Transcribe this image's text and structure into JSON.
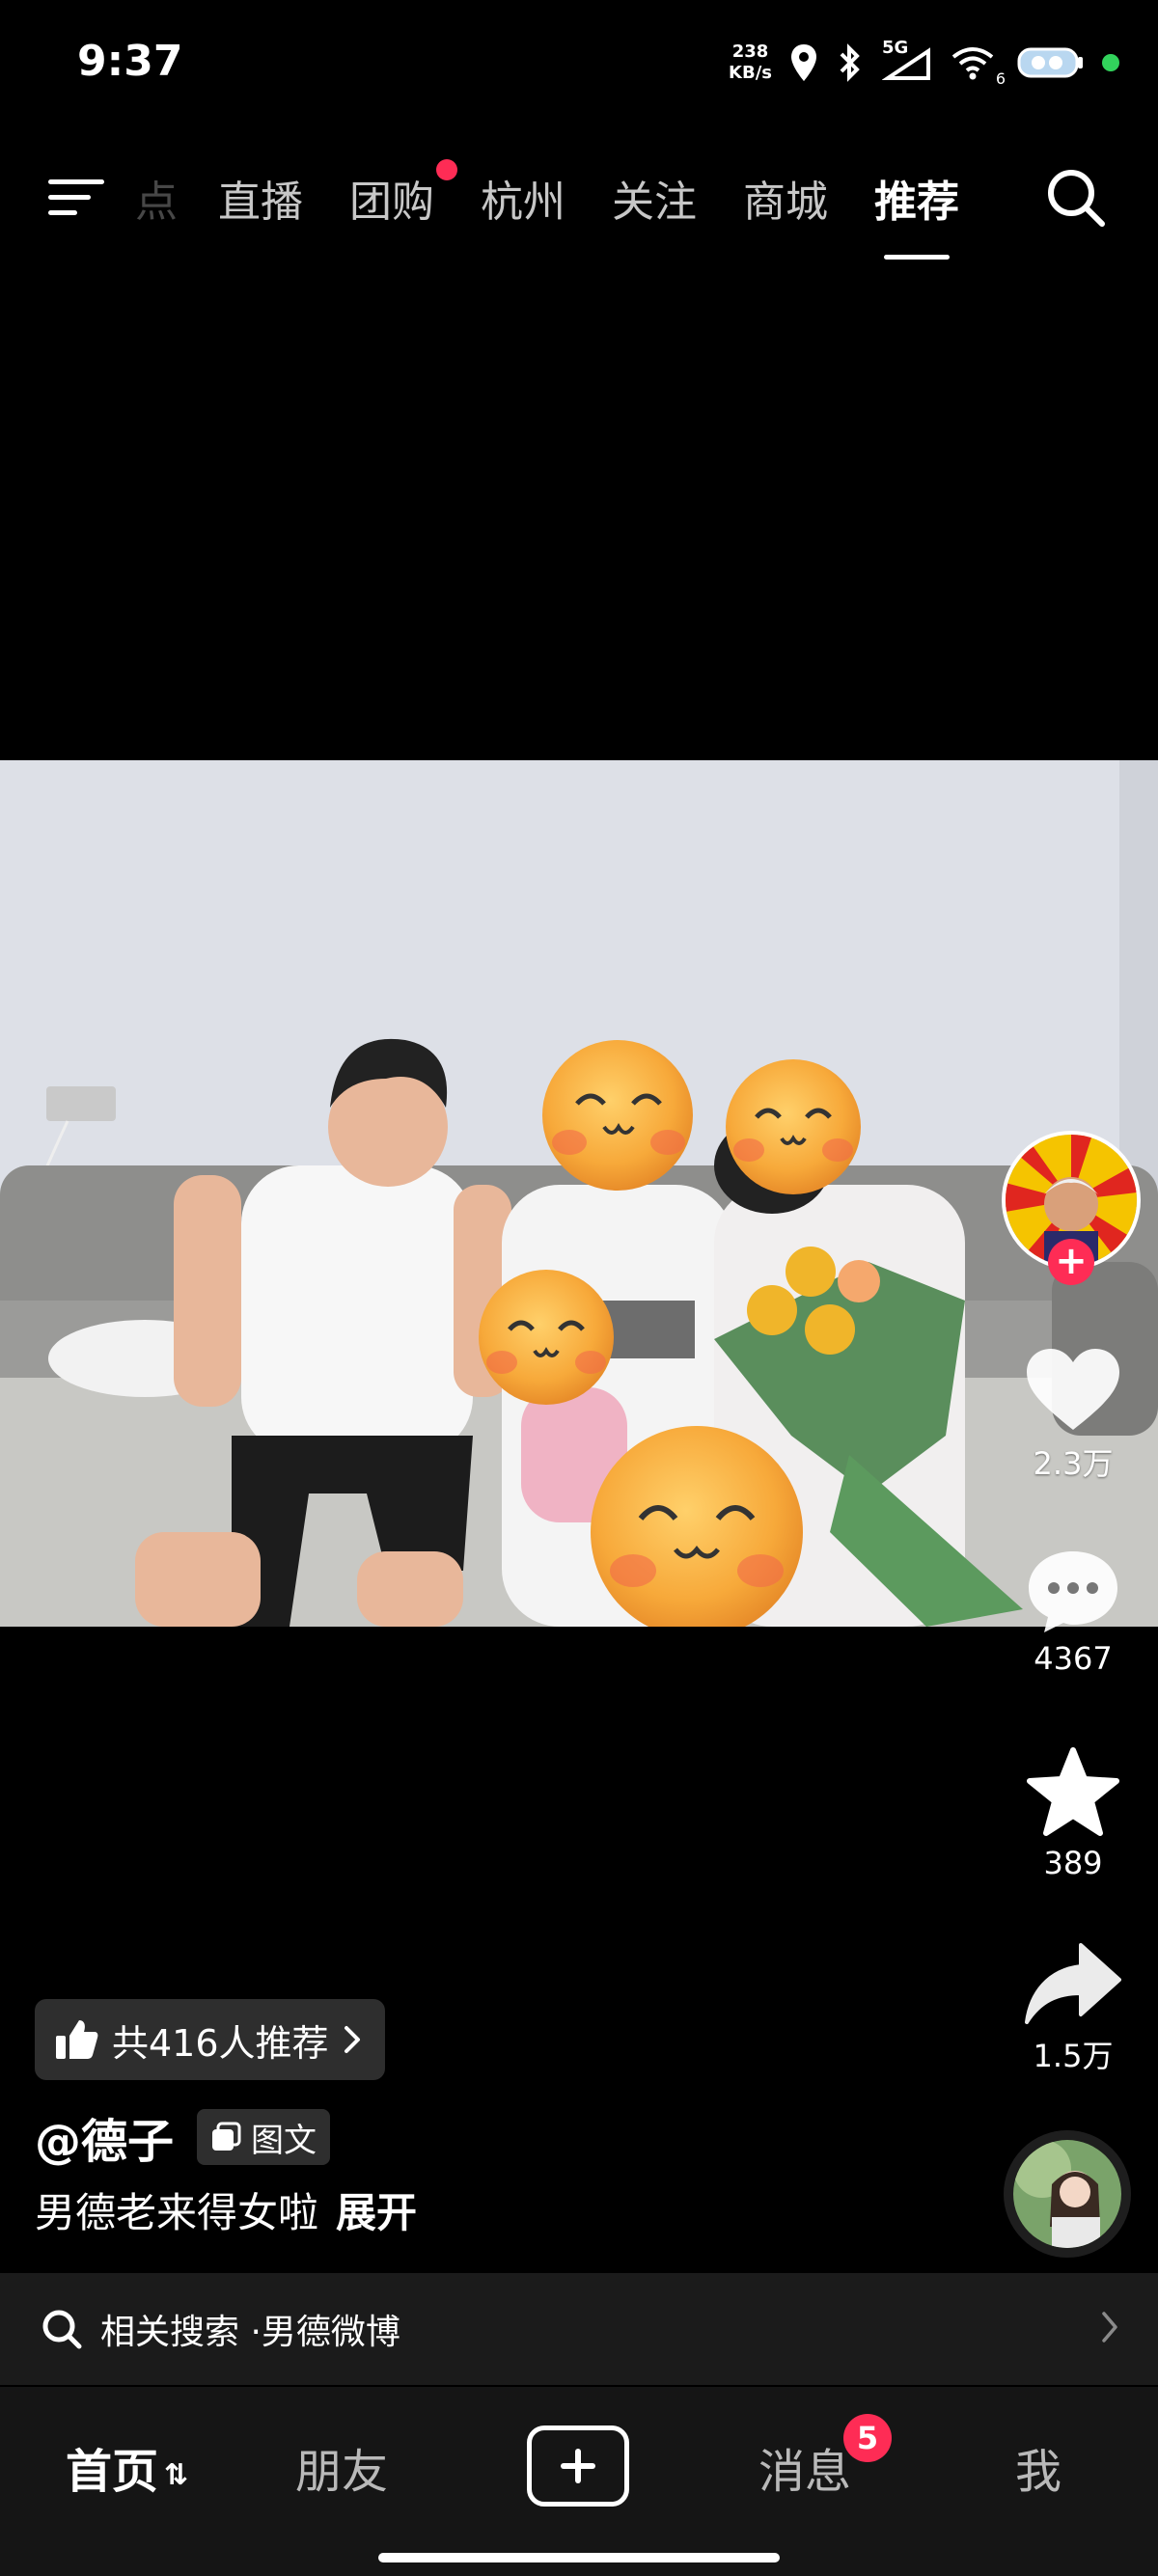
{
  "status_bar": {
    "time": "9:37",
    "net_speed_value": "238",
    "net_speed_unit": "KB/s",
    "network_type": "5G",
    "wifi_label": "6"
  },
  "top_nav": {
    "tabs": [
      {
        "label": "点",
        "state": "faded"
      },
      {
        "label": "直播"
      },
      {
        "label": "团购",
        "has_dot": true
      },
      {
        "label": "杭州"
      },
      {
        "label": "关注"
      },
      {
        "label": "商城"
      },
      {
        "label": "推荐",
        "active": true
      }
    ]
  },
  "actions": {
    "like_count": "2.3万",
    "comment_count": "4367",
    "favorite_count": "389",
    "share_count": "1.5万"
  },
  "post": {
    "recommend_text": "共416人推荐",
    "author": "@德子",
    "type_badge": "图文",
    "caption": "男德老来得女啦",
    "expand_label": "展开"
  },
  "related_search": {
    "prefix": "相关搜索 · ",
    "query": "男德微博"
  },
  "bottom_tabs": {
    "home": "首页",
    "friends": "朋友",
    "messages": "消息",
    "messages_badge": "5",
    "me": "我"
  },
  "colors": {
    "accent": "#fe2c55",
    "background": "#000000",
    "bar": "#151515"
  }
}
